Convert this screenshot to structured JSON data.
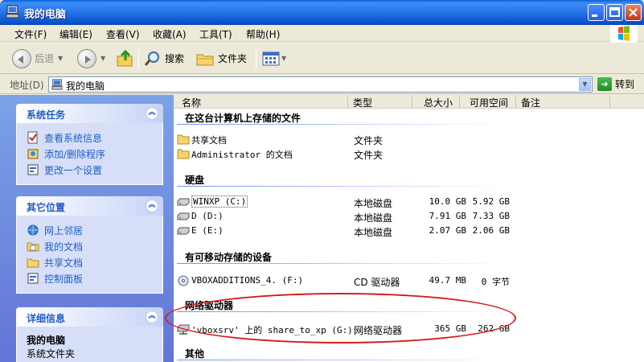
{
  "window": {
    "title": "我的电脑"
  },
  "menu": {
    "items": [
      "文件(F)",
      "编辑(E)",
      "查看(V)",
      "收藏(A)",
      "工具(T)",
      "帮助(H)"
    ]
  },
  "toolbar": {
    "back_label": "后退",
    "search_label": "搜索",
    "folders_label": "文件夹"
  },
  "address": {
    "label": "地址(D)",
    "value": "我的电脑",
    "go_label": "转到"
  },
  "left": {
    "system_tasks": {
      "title": "系统任务",
      "items": [
        "查看系统信息",
        "添加/删除程序",
        "更改一个设置"
      ]
    },
    "other_places": {
      "title": "其它位置",
      "items": [
        "网上邻居",
        "我的文档",
        "共享文档",
        "控制面板"
      ]
    },
    "details": {
      "title": "详细信息",
      "name": "我的电脑",
      "subtitle": "系统文件夹"
    }
  },
  "columns": [
    "名称",
    "类型",
    "总大小",
    "可用空间",
    "备注"
  ],
  "groups": {
    "stored": {
      "title": "在这台计算机上存储的文件",
      "rows": [
        {
          "name": "共享文档",
          "type": "文件夹"
        },
        {
          "name": "Administrator 的文档",
          "type": "文件夹"
        }
      ]
    },
    "hdd": {
      "title": "硬盘",
      "rows": [
        {
          "name": "WINXP (C:)",
          "type": "本地磁盘",
          "total": "10.0 GB",
          "free": "5.92 GB"
        },
        {
          "name": "D (D:)",
          "type": "本地磁盘",
          "total": "7.91 GB",
          "free": "7.33 GB"
        },
        {
          "name": "E (E:)",
          "type": "本地磁盘",
          "total": "2.07 GB",
          "free": "2.06 GB"
        }
      ]
    },
    "removable": {
      "title": "有可移动存储的设备",
      "rows": [
        {
          "name": "VBOXADDITIONS_4. (F:)",
          "type": "CD 驱动器",
          "total": "49.7 MB",
          "free": "0 字节"
        }
      ]
    },
    "network": {
      "title": "网络驱动器",
      "rows": [
        {
          "name": "'vboxsrv' 上的 share_to_xp (G:)",
          "type": "网络驱动器",
          "total": "365 GB",
          "free": "262 GB"
        }
      ]
    },
    "other": {
      "title": "其他"
    }
  },
  "colors": {
    "title_bar": "#2a76ec",
    "task_link": "#215dc6",
    "annotation": "#d61c1c"
  }
}
